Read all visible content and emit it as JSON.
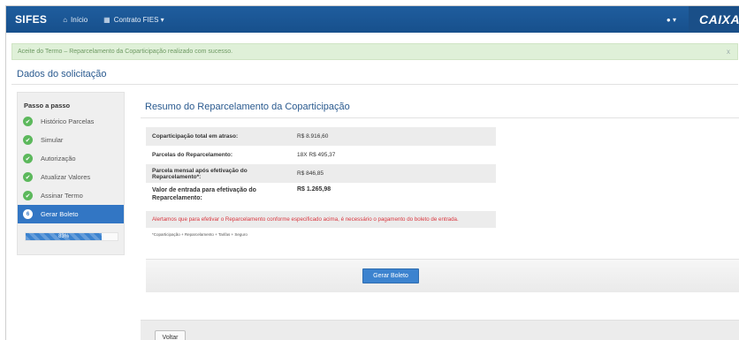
{
  "nav": {
    "brand": "SIFES",
    "home_label": "Início",
    "contract_menu_label": "Contrato FIES ▾",
    "user_menu": "▾",
    "logo_text": "CAIXA"
  },
  "alert": {
    "message": "Aceite do Termo – Reparcelamento da Coparticipação realizado com sucesso.",
    "close": "x"
  },
  "page": {
    "title": "Dados do solicitação"
  },
  "sidebar": {
    "heading": "Passo a passo",
    "steps": [
      {
        "label": "Histórico Parcelas",
        "status": "done"
      },
      {
        "label": "Simular",
        "status": "done"
      },
      {
        "label": "Autorização",
        "status": "done"
      },
      {
        "label": "Atualizar Valores",
        "status": "done"
      },
      {
        "label": "Assinar Termo",
        "status": "done"
      },
      {
        "label": "Gerar Boleto",
        "status": "active",
        "number": "6"
      }
    ],
    "progress": {
      "value": 0.83,
      "label": "83%"
    }
  },
  "main": {
    "title": "Resumo do Reparcelamento da Coparticipação",
    "rows": [
      {
        "label": "Coparticipação total em atraso:",
        "value": "R$ 8.916,60"
      },
      {
        "label": "Parcelas do Reparcelamento:",
        "value": "18X R$ 495,37"
      },
      {
        "label": "Parcela mensal após efetivação do Reparcelamento*:",
        "value": "R$ 846,85"
      },
      {
        "label": "Valor de entrada para efetivação do Reparcelamento:",
        "value": "R$ 1.265,98"
      }
    ],
    "warning": "Alertamos que para efetivar o Reparcelamento conforme especificado acima, é necessário o pagamento do boleto de entrada.",
    "footnote": "*Coparticipação + Reparcelamento + Tarifas + Seguro",
    "generate_button": "Gerar Boleto",
    "back_button": "Voltar"
  },
  "colors": {
    "navbar": "#1f5d9e",
    "primary": "#3c83cf",
    "success": "#5cb85c",
    "warning_text": "#d9363e",
    "alert_bg": "#dff0d8"
  },
  "icons": [
    "home-icon",
    "grid-icon",
    "user-icon",
    "check-icon",
    "close-icon"
  ]
}
